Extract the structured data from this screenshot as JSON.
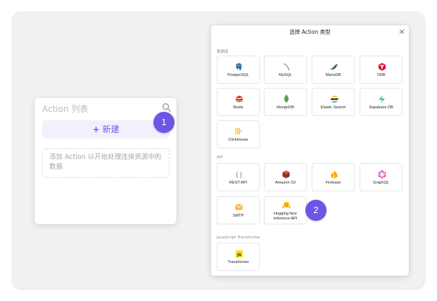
{
  "list_panel": {
    "title": "Action 列表",
    "new_button_plus": "+",
    "new_button_label": "新建",
    "empty_hint": "添加 Action 以开始处理连接资源中的数据"
  },
  "badges": {
    "one": "1",
    "two": "2"
  },
  "modal": {
    "title": "选择 Action 类型",
    "sections": {
      "database": "数据库",
      "api": "API",
      "js": "JavaScript Transformer"
    },
    "database_items": [
      {
        "label": "PostgreSQL",
        "icon": "postgresql-icon"
      },
      {
        "label": "MySQL",
        "icon": "mysql-icon"
      },
      {
        "label": "MariaDB",
        "icon": "mariadb-icon"
      },
      {
        "label": "TiDB",
        "icon": "tidb-icon"
      },
      {
        "label": "Redis",
        "icon": "redis-icon"
      },
      {
        "label": "MongoDB",
        "icon": "mongodb-icon"
      },
      {
        "label": "Elastic Search",
        "icon": "elasticsearch-icon"
      },
      {
        "label": "Supabase DB",
        "icon": "supabase-icon"
      },
      {
        "label": "ClickHouse",
        "icon": "clickhouse-icon"
      }
    ],
    "api_items": [
      {
        "label": "REST API",
        "icon": "rest-api-icon"
      },
      {
        "label": "Amazon S3",
        "icon": "amazon-s3-icon"
      },
      {
        "label": "Firebase",
        "icon": "firebase-icon"
      },
      {
        "label": "GraphQL",
        "icon": "graphql-icon"
      },
      {
        "label": "SMTP",
        "icon": "smtp-icon"
      },
      {
        "label": "Hugging face Inference API",
        "label_line1": "Hugging face",
        "label_line2": "Inference API",
        "icon": "hugging-face-icon"
      }
    ],
    "js_items": [
      {
        "label": "Transformer",
        "icon": "transformer-icon"
      }
    ]
  },
  "colors": {
    "accent": "#6b56e6",
    "new_button_bg": "#f1f0fd",
    "frame_bg": "#f1f1f3"
  }
}
